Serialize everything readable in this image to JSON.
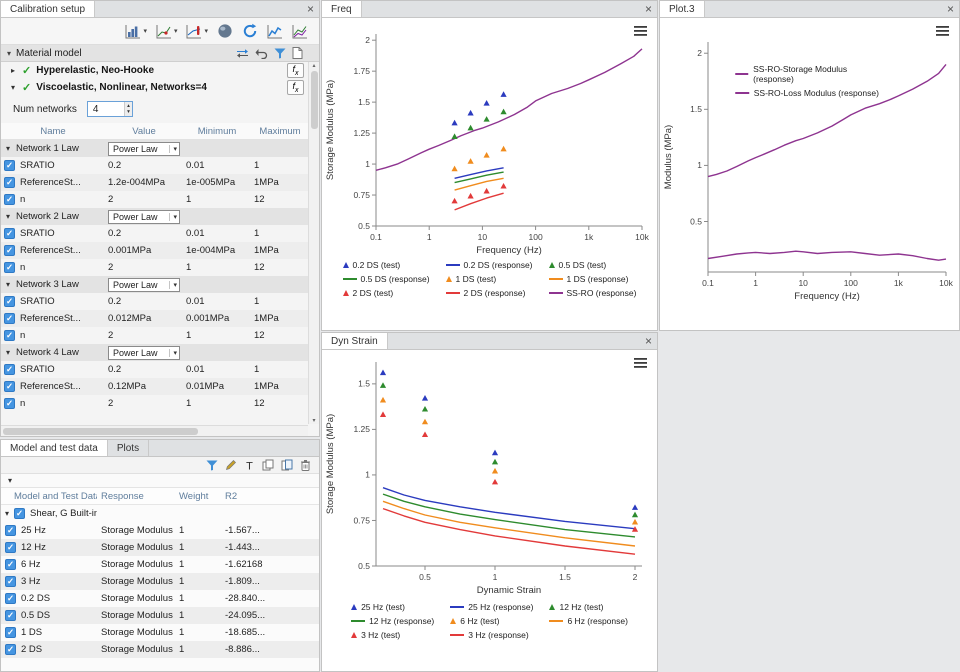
{
  "icons": {
    "close": "×",
    "caret_down": "▾",
    "caret_right": "▸",
    "check": "✓",
    "spin_up": "▴",
    "spin_down": "▾"
  },
  "colors": {
    "blue": "#2b3bbf",
    "green": "#2e8b2e",
    "orange": "#f08c1e",
    "red": "#e23a3a",
    "purple": "#8e3490",
    "checkbox": "#4595e1"
  },
  "calibration_panel": {
    "tab": "Calibration setup",
    "material_header": "Material model",
    "toolbar_buttons": [
      {
        "name": "histogram-tool-button",
        "icon": "histogram-chart-icon",
        "dropdown": true
      },
      {
        "name": "point-chart-tool-button",
        "icon": "point-chart-icon",
        "dropdown": true
      },
      {
        "name": "thermo-chart-tool-button",
        "icon": "thermo-chart-icon",
        "dropdown": true
      },
      {
        "name": "sphere-tool-button",
        "icon": "sphere-icon",
        "dropdown": false
      },
      {
        "name": "run-calibration-button",
        "icon": "refresh-icon",
        "dropdown": false
      },
      {
        "name": "line-chart-tool-button",
        "icon": "line-chart-icon",
        "dropdown": false
      },
      {
        "name": "multi-chart-tool-button",
        "icon": "multi-line-chart-icon",
        "dropdown": false
      }
    ],
    "header_icons": [
      {
        "name": "swap-button",
        "icon": "swap-arrows-icon"
      },
      {
        "name": "undo-button",
        "icon": "undo-icon"
      },
      {
        "name": "filter-button",
        "icon": "filter-icon"
      },
      {
        "name": "export-page-button",
        "icon": "page-icon"
      }
    ],
    "models": [
      {
        "label": "Hyperelastic, Neo-Hooke"
      },
      {
        "label": "Viscoelastic, Nonlinear, Networks=4"
      }
    ],
    "num_networks": {
      "label": "Num networks",
      "value": "4"
    },
    "table": {
      "headers": [
        "Name",
        "Value",
        "Minimum",
        "Maximum"
      ],
      "rows": [
        {
          "type": "group",
          "name": "Network 1 Law",
          "value": "Power Law"
        },
        {
          "type": "param",
          "name": "SRATIO",
          "value": "0.2",
          "min": "0.01",
          "max": "1"
        },
        {
          "type": "param",
          "name": "ReferenceSt...",
          "value": "1.2e-004MPa",
          "min": "1e-005MPa",
          "max": "1MPa"
        },
        {
          "type": "param",
          "name": "n",
          "value": "2",
          "min": "1",
          "max": "12"
        },
        {
          "type": "group",
          "name": "Network 2 Law",
          "value": "Power Law"
        },
        {
          "type": "param",
          "name": "SRATIO",
          "value": "0.2",
          "min": "0.01",
          "max": "1"
        },
        {
          "type": "param",
          "name": "ReferenceSt...",
          "value": "0.001MPa",
          "min": "1e-004MPa",
          "max": "1MPa"
        },
        {
          "type": "param",
          "name": "n",
          "value": "2",
          "min": "1",
          "max": "12"
        },
        {
          "type": "group",
          "name": "Network 3 Law",
          "value": "Power Law"
        },
        {
          "type": "param",
          "name": "SRATIO",
          "value": "0.2",
          "min": "0.01",
          "max": "1"
        },
        {
          "type": "param",
          "name": "ReferenceSt...",
          "value": "0.012MPa",
          "min": "0.001MPa",
          "max": "1MPa"
        },
        {
          "type": "param",
          "name": "n",
          "value": "2",
          "min": "1",
          "max": "12"
        },
        {
          "type": "group",
          "name": "Network 4 Law",
          "value": "Power Law"
        },
        {
          "type": "param",
          "name": "SRATIO",
          "value": "0.2",
          "min": "0.01",
          "max": "1"
        },
        {
          "type": "param",
          "name": "ReferenceSt...",
          "value": "0.12MPa",
          "min": "0.01MPa",
          "max": "1MPa"
        },
        {
          "type": "param",
          "name": "n",
          "value": "2",
          "min": "1",
          "max": "12"
        }
      ]
    }
  },
  "data_panel": {
    "tabs": [
      {
        "label": "Model and test data",
        "active": true
      },
      {
        "label": "Plots",
        "active": false
      }
    ],
    "toolbar_icons": [
      {
        "name": "filter-data-button",
        "icon": "filter-icon"
      },
      {
        "name": "edit-data-button",
        "icon": "pencil-icon"
      },
      {
        "name": "text-tool-button",
        "icon": "text-icon"
      },
      {
        "name": "copy-data-button",
        "icon": "copy-icon"
      },
      {
        "name": "duplicate-data-button",
        "icon": "pages-icon"
      },
      {
        "name": "delete-data-button",
        "icon": "trash-icon"
      }
    ],
    "table": {
      "headers": [
        "Model and Test Data",
        "Response",
        "Weight",
        "R2"
      ],
      "group_label": "Shear, G Built-in ...",
      "rows": [
        {
          "name": "25 Hz",
          "response": "Storage Modulus",
          "weight": "1",
          "r2": "-1.567..."
        },
        {
          "name": "12 Hz",
          "response": "Storage Modulus",
          "weight": "1",
          "r2": "-1.443..."
        },
        {
          "name": "6 Hz",
          "response": "Storage Modulus",
          "weight": "1",
          "r2": "-1.62168"
        },
        {
          "name": "3 Hz",
          "response": "Storage Modulus",
          "weight": "1",
          "r2": "-1.809..."
        },
        {
          "name": "0.2 DS",
          "response": "Storage Modulus",
          "weight": "1",
          "r2": "-28.840..."
        },
        {
          "name": "0.5 DS",
          "response": "Storage Modulus",
          "weight": "1",
          "r2": "-24.095..."
        },
        {
          "name": "1 DS",
          "response": "Storage Modulus",
          "weight": "1",
          "r2": "-18.685..."
        },
        {
          "name": "2 DS",
          "response": "Storage Modulus",
          "weight": "1",
          "r2": "-8.886..."
        }
      ]
    }
  },
  "chart_panels": {
    "freq": {
      "tab": "Freq"
    },
    "plot3": {
      "tab": "Plot.3"
    },
    "dyn": {
      "tab": "Dyn Strain"
    }
  },
  "chart_data": [
    {
      "id": "freq",
      "type": "line",
      "title": "",
      "xlabel": "Frequency (Hz)",
      "ylabel": "Storage Modulus (MPa)",
      "xscale": "log",
      "xlim": [
        0.1,
        10000
      ],
      "ylim": [
        0.5,
        2.05
      ],
      "grid": false,
      "legend_position": "bottom",
      "xticks": [
        {
          "v": 0.1,
          "label": "0.1"
        },
        {
          "v": 1,
          "label": "1"
        },
        {
          "v": 10,
          "label": "10"
        },
        {
          "v": 100,
          "label": "100"
        },
        {
          "v": 1000,
          "label": "1k"
        },
        {
          "v": 10000,
          "label": "10k"
        }
      ],
      "yticks": [
        0.5,
        0.75,
        1,
        1.25,
        1.5,
        1.75,
        2
      ],
      "series": [
        {
          "name": "SS-RO (response)",
          "type": "line",
          "color": "#8e3490",
          "x": [
            0.1,
            0.15,
            0.25,
            0.4,
            0.7,
            1,
            1.5,
            2.5,
            4,
            7,
            10,
            20,
            40,
            70,
            100,
            200,
            400,
            700,
            1000,
            2000,
            4000,
            7000,
            10000
          ],
          "y": [
            0.95,
            0.97,
            1.0,
            1.04,
            1.09,
            1.12,
            1.15,
            1.19,
            1.23,
            1.27,
            1.29,
            1.34,
            1.4,
            1.46,
            1.51,
            1.57,
            1.61,
            1.65,
            1.68,
            1.74,
            1.81,
            1.87,
            1.93
          ]
        },
        {
          "name": "0.2 DS (test)",
          "type": "scatter",
          "marker": "triangle",
          "color": "#2b3bbf",
          "x": [
            3,
            6,
            12,
            25
          ],
          "y": [
            1.33,
            1.41,
            1.49,
            1.56
          ]
        },
        {
          "name": "0.2 DS (response)",
          "type": "line",
          "color": "#2b3bbf",
          "x": [
            3,
            6,
            12,
            25
          ],
          "y": [
            0.885,
            0.915,
            0.945,
            0.97
          ]
        },
        {
          "name": "0.5 DS (test)",
          "type": "scatter",
          "marker": "triangle",
          "color": "#2e8b2e",
          "x": [
            3,
            6,
            12,
            25
          ],
          "y": [
            1.22,
            1.29,
            1.36,
            1.42
          ]
        },
        {
          "name": "0.5 DS (response)",
          "type": "line",
          "color": "#2e8b2e",
          "x": [
            3,
            6,
            12,
            25
          ],
          "y": [
            0.85,
            0.88,
            0.91,
            0.935
          ]
        },
        {
          "name": "1 DS (test)",
          "type": "scatter",
          "marker": "triangle",
          "color": "#f08c1e",
          "x": [
            3,
            6,
            12,
            25
          ],
          "y": [
            0.96,
            1.02,
            1.07,
            1.12
          ]
        },
        {
          "name": "1 DS (response)",
          "type": "line",
          "color": "#f08c1e",
          "x": [
            3,
            6,
            12,
            25
          ],
          "y": [
            0.79,
            0.825,
            0.86,
            0.885
          ]
        },
        {
          "name": "2 DS (test)",
          "type": "scatter",
          "marker": "triangle",
          "color": "#e23a3a",
          "x": [
            3,
            6,
            12,
            25
          ],
          "y": [
            0.7,
            0.74,
            0.78,
            0.82
          ]
        },
        {
          "name": "2 DS (response)",
          "type": "line",
          "color": "#e23a3a",
          "x": [
            3,
            6,
            12,
            25
          ],
          "y": [
            0.63,
            0.68,
            0.725,
            0.765
          ]
        }
      ],
      "legend": [
        {
          "marker": "triangle",
          "color": "#2b3bbf",
          "label": "0.2 DS (test)"
        },
        {
          "marker": "line",
          "color": "#2b3bbf",
          "label": "0.2 DS (response)"
        },
        {
          "marker": "triangle",
          "color": "#2e8b2e",
          "label": "0.5 DS (test)"
        },
        {
          "marker": "line",
          "color": "#2e8b2e",
          "label": "0.5 DS (response)"
        },
        {
          "marker": "triangle",
          "color": "#f08c1e",
          "label": "1 DS (test)"
        },
        {
          "marker": "line",
          "color": "#f08c1e",
          "label": "1 DS (response)"
        },
        {
          "marker": "triangle",
          "color": "#e23a3a",
          "label": "2 DS (test)"
        },
        {
          "marker": "line",
          "color": "#e23a3a",
          "label": "2 DS (response)"
        },
        {
          "marker": "line",
          "color": "#8e3490",
          "label": "SS-RO (response)"
        }
      ]
    },
    {
      "id": "plot3",
      "type": "line",
      "title": "",
      "xlabel": "Frequency (Hz)",
      "ylabel": "Modulus (MPa)",
      "xscale": "log",
      "xlim": [
        0.1,
        10000
      ],
      "ylim": [
        0.05,
        2.1
      ],
      "grid": false,
      "legend_position": "top-inside",
      "xticks": [
        {
          "v": 0.1,
          "label": "0.1"
        },
        {
          "v": 1,
          "label": "1"
        },
        {
          "v": 10,
          "label": "10"
        },
        {
          "v": 100,
          "label": "100"
        },
        {
          "v": 1000,
          "label": "1k"
        },
        {
          "v": 10000,
          "label": "10k"
        }
      ],
      "yticks": [
        0.5,
        1,
        1.5,
        2
      ],
      "series": [
        {
          "name": "SS-RO-Storage Modulus (response)",
          "type": "line",
          "color": "#8e3490",
          "x": [
            0.1,
            0.15,
            0.25,
            0.4,
            0.7,
            1,
            1.5,
            2.5,
            4,
            7,
            10,
            20,
            40,
            70,
            100,
            200,
            400,
            700,
            1000,
            2000,
            4000,
            7000,
            10000
          ],
          "y": [
            0.9,
            0.92,
            0.95,
            0.99,
            1.04,
            1.07,
            1.1,
            1.14,
            1.18,
            1.22,
            1.24,
            1.29,
            1.35,
            1.41,
            1.45,
            1.51,
            1.55,
            1.59,
            1.62,
            1.68,
            1.75,
            1.82,
            1.9
          ]
        },
        {
          "name": "SS-RO-Loss Modulus (response)",
          "type": "line",
          "color": "#8e3490",
          "x": [
            0.1,
            0.2,
            0.4,
            0.7,
            1,
            2,
            4,
            7,
            10,
            20,
            40,
            100,
            200,
            400,
            1000,
            2000,
            4000,
            7000,
            10000
          ],
          "y": [
            0.17,
            0.19,
            0.21,
            0.22,
            0.225,
            0.215,
            0.225,
            0.235,
            0.23,
            0.215,
            0.225,
            0.23,
            0.215,
            0.2,
            0.21,
            0.195,
            0.17,
            0.155,
            0.165
          ]
        }
      ],
      "legend": [
        {
          "marker": "line",
          "color": "#8e3490",
          "label": "SS-RO-Storage Modulus (response)"
        },
        {
          "marker": "line",
          "color": "#8e3490",
          "label": "SS-RO-Loss Modulus (response)"
        }
      ]
    },
    {
      "id": "dyn",
      "type": "line",
      "title": "",
      "xlabel": "Dynamic Strain",
      "ylabel": "Storage Modulus (MPa)",
      "xscale": "linear",
      "xlim": [
        0.15,
        2.05
      ],
      "ylim": [
        0.5,
        1.62
      ],
      "grid": false,
      "legend_position": "bottom",
      "xticks": [
        0.5,
        1,
        1.5,
        2
      ],
      "yticks": [
        0.5,
        0.75,
        1,
        1.25,
        1.5
      ],
      "series": [
        {
          "name": "25 Hz (test)",
          "type": "scatter",
          "marker": "triangle",
          "color": "#2b3bbf",
          "x": [
            0.2,
            0.5,
            1,
            2
          ],
          "y": [
            1.56,
            1.42,
            1.12,
            0.82
          ]
        },
        {
          "name": "25 Hz (response)",
          "type": "line",
          "color": "#2b3bbf",
          "x": [
            0.2,
            0.35,
            0.5,
            0.75,
            1,
            1.5,
            2
          ],
          "y": [
            0.93,
            0.89,
            0.86,
            0.825,
            0.795,
            0.745,
            0.705
          ]
        },
        {
          "name": "12 Hz (test)",
          "type": "scatter",
          "marker": "triangle",
          "color": "#2e8b2e",
          "x": [
            0.2,
            0.5,
            1,
            2
          ],
          "y": [
            1.49,
            1.36,
            1.07,
            0.78
          ]
        },
        {
          "name": "12 Hz (response)",
          "type": "line",
          "color": "#2e8b2e",
          "x": [
            0.2,
            0.35,
            0.5,
            0.75,
            1,
            1.5,
            2
          ],
          "y": [
            0.895,
            0.855,
            0.825,
            0.785,
            0.755,
            0.7,
            0.66
          ]
        },
        {
          "name": "6 Hz (test)",
          "type": "scatter",
          "marker": "triangle",
          "color": "#f08c1e",
          "x": [
            0.2,
            0.5,
            1,
            2
          ],
          "y": [
            1.41,
            1.29,
            1.02,
            0.74
          ]
        },
        {
          "name": "6 Hz (response)",
          "type": "line",
          "color": "#f08c1e",
          "x": [
            0.2,
            0.35,
            0.5,
            0.75,
            1,
            1.5,
            2
          ],
          "y": [
            0.855,
            0.815,
            0.78,
            0.74,
            0.71,
            0.655,
            0.61
          ]
        },
        {
          "name": "3 Hz (test)",
          "type": "scatter",
          "marker": "triangle",
          "color": "#e23a3a",
          "x": [
            0.2,
            0.5,
            1,
            2
          ],
          "y": [
            1.33,
            1.22,
            0.96,
            0.7
          ]
        },
        {
          "name": "3 Hz (response)",
          "type": "line",
          "color": "#e23a3a",
          "x": [
            0.2,
            0.35,
            0.5,
            0.75,
            1,
            1.5,
            2
          ],
          "y": [
            0.815,
            0.775,
            0.74,
            0.7,
            0.665,
            0.61,
            0.565
          ]
        }
      ],
      "legend": [
        {
          "marker": "triangle",
          "color": "#2b3bbf",
          "label": "25 Hz (test)"
        },
        {
          "marker": "line",
          "color": "#2b3bbf",
          "label": "25 Hz (response)"
        },
        {
          "marker": "triangle",
          "color": "#2e8b2e",
          "label": "12 Hz (test)"
        },
        {
          "marker": "line",
          "color": "#2e8b2e",
          "label": "12 Hz (response)"
        },
        {
          "marker": "triangle",
          "color": "#f08c1e",
          "label": "6 Hz (test)"
        },
        {
          "marker": "line",
          "color": "#f08c1e",
          "label": "6 Hz (response)"
        },
        {
          "marker": "triangle",
          "color": "#e23a3a",
          "label": "3 Hz (test)"
        },
        {
          "marker": "line",
          "color": "#e23a3a",
          "label": "3 Hz (response)"
        }
      ]
    }
  ]
}
